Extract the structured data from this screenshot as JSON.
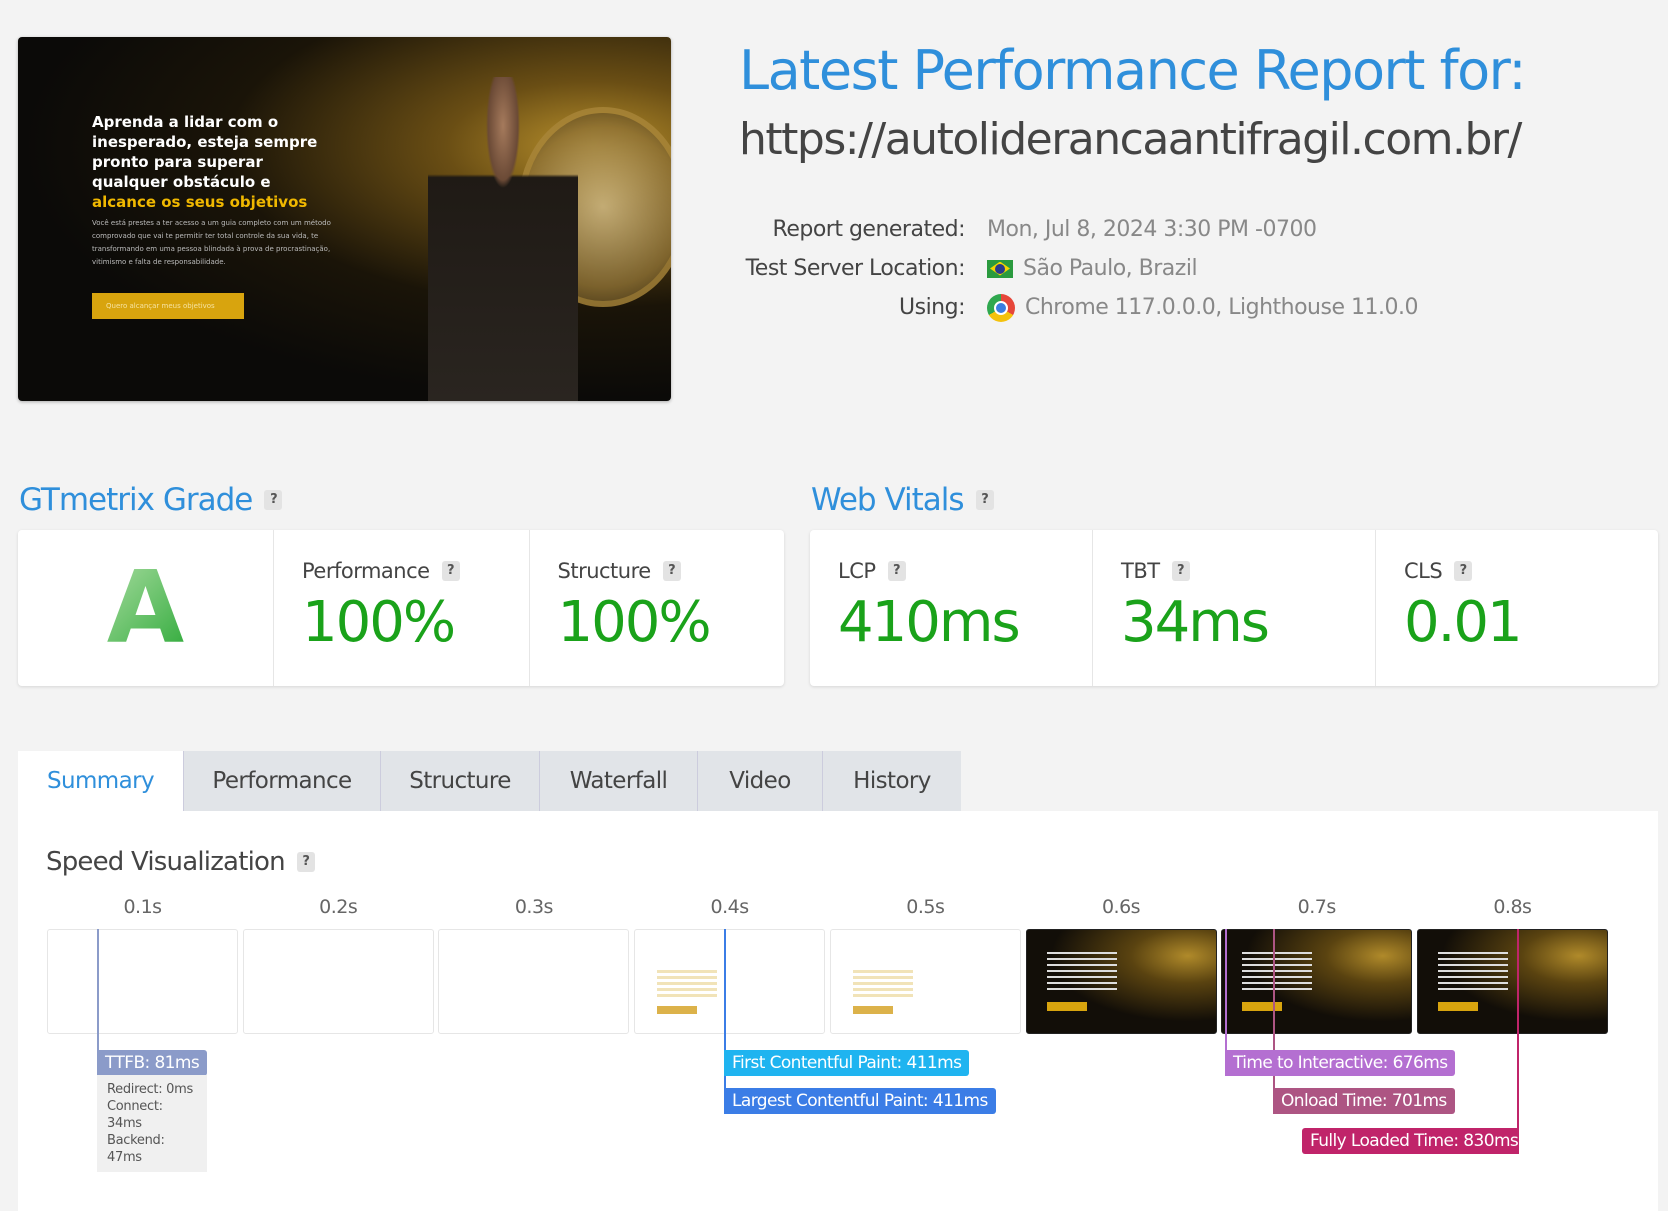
{
  "screenshot": {
    "headline_lines": [
      "Aprenda a lidar com o",
      "inesperado, esteja sempre",
      "pronto para superar",
      "qualquer obstáculo e"
    ],
    "headline_highlight": "alcance os seus objetivos",
    "subtext": "Você está prestes a ter acesso a um guia completo com um método comprovado que vai te permitir ter total controle da sua vida, te transformando em uma pessoa blindada à prova de procrastinação, vitimismo e falta de responsabilidade.",
    "cta": "Quero alcançar meus objetivos"
  },
  "header": {
    "title": "Latest Performance Report for:",
    "url": "https://autoliderancaantifragil.com.br/",
    "report_generated_label": "Report generated:",
    "report_generated": "Mon, Jul 8, 2024 3:30 PM -0700",
    "location_label": "Test Server Location:",
    "location": "São Paulo, Brazil",
    "using_label": "Using:",
    "using": "Chrome 117.0.0.0, Lighthouse 11.0.0"
  },
  "grade": {
    "heading": "GTmetrix Grade",
    "letter": "A",
    "performance_label": "Performance",
    "performance": "100%",
    "structure_label": "Structure",
    "structure": "100%"
  },
  "vitals": {
    "heading": "Web Vitals",
    "lcp_label": "LCP",
    "lcp": "410ms",
    "tbt_label": "TBT",
    "tbt": "34ms",
    "cls_label": "CLS",
    "cls": "0.01"
  },
  "help": "?",
  "tabs": [
    "Summary",
    "Performance",
    "Structure",
    "Waterfall",
    "Video",
    "History"
  ],
  "speed": {
    "heading": "Speed Visualization",
    "times": [
      "0.1s",
      "0.2s",
      "0.3s",
      "0.4s",
      "0.5s",
      "0.6s",
      "0.7s",
      "0.8s"
    ],
    "frames": [
      "blank",
      "blank",
      "blank",
      "faint",
      "faint",
      "dark",
      "dark",
      "dark"
    ],
    "ttfb": "TTFB: 81ms",
    "ttfb_details": [
      "Redirect: 0ms",
      "Connect: 34ms",
      "Backend: 47ms"
    ],
    "fcp": "First Contentful Paint: 411ms",
    "lcp": "Largest Contentful Paint: 411ms",
    "tti": "Time to Interactive: 676ms",
    "onload": "Onload Time: 701ms",
    "fully_loaded": "Fully Loaded Time: 830ms"
  },
  "colors": {
    "accent": "#2f8fdb",
    "good": "#1aa21a",
    "ttfb": "#8b9bc9",
    "fcp": "#1fb4f0",
    "lcp": "#3b7de6",
    "tti": "#b46fd1",
    "onload": "#ad5583",
    "fully_loaded": "#c0246a"
  }
}
